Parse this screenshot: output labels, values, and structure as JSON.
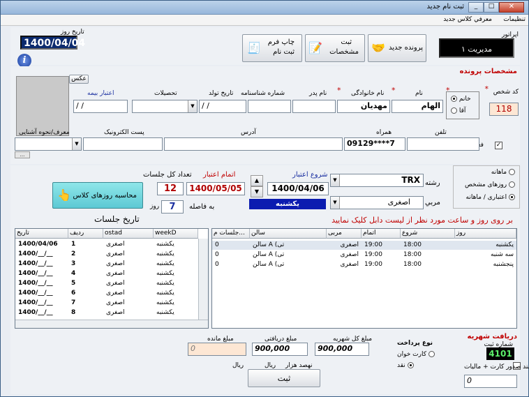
{
  "window": {
    "title": "ثبت نام جدید"
  },
  "menu": {
    "items": [
      "تنظیمات",
      "معرفي كلاس جديد"
    ]
  },
  "operator": {
    "label": "اپراتور",
    "value": "مدیریت ۱"
  },
  "date": {
    "label": "تاریخ روز",
    "value": "1400/04/04"
  },
  "toolbar": {
    "new_file": "پرونده جدید",
    "save_specs_1": "ثبت",
    "save_specs_2": "مشخصات",
    "print_1": "چاپ فرم",
    "print_2": "ثبت نام"
  },
  "section_profile": "مشخصات پرونده",
  "photo_label": "عکس",
  "fields": {
    "code_label": "کد شخص",
    "code": "118",
    "gender_female": "خانم",
    "gender_male": "آقا",
    "first_name_label": "نام",
    "first_name": "الهام",
    "last_name_label": "نام خانوادگی",
    "last_name": "مهدیان",
    "father_label": "نام پدر",
    "father": "",
    "id_label": "شماره شناسنامه",
    "id": "",
    "birth_label": "تاریخ تولد",
    "birth": "/ /",
    "education_label": "تحصیلات",
    "education": "",
    "insurance_label": "اعتبار بیمه",
    "insurance": "/ /",
    "phone_label": "تلفن",
    "phone": "",
    "mobile_label": "همراه",
    "mobile": "09129****7",
    "address_label": "آدرس",
    "address": "",
    "postal_label": "پست الکترونیک",
    "postal": "",
    "referrer_label": "معرف/نحوه آشنایی",
    "referrer": "",
    "active_label": "فعال"
  },
  "class": {
    "monthly": "ماهانه",
    "specific_days": "روزهای مشخص",
    "credit_monthly": "اعتباری / ماهانه",
    "field_label": "رشته",
    "field": "TRX",
    "coach_label": "مربي",
    "coach": "اصغری",
    "start_label": "شروع اعتبار",
    "start": "1400/04/06",
    "start_day": "یکشنبه",
    "end_label": "اتمام اعتبار",
    "end": "1400/05/05",
    "sessions_label": "تعداد کل جلسات",
    "sessions": "12",
    "interval_label": "به فاصله",
    "interval": "7",
    "interval_unit": "روز",
    "calc_button": "محاسبه روزهای کلاس",
    "hint": "بر روی روز و ساعت مورد نظر از لیست دابل کلیک نمایید"
  },
  "sessions_title": "تاریخ جلسات",
  "sessions_table": {
    "headers": [
      "تاریخ",
      "ردیف",
      "ostad",
      "weekD"
    ],
    "rows": [
      [
        "1400/04/06",
        "1",
        "اصغری",
        "یکشنبه"
      ],
      [
        "1400/__/__",
        "2",
        "اصغری",
        "یکشنبه"
      ],
      [
        "1400/__/__",
        "3",
        "اصغری",
        "یکشنبه"
      ],
      [
        "1400/__/__",
        "4",
        "اصغری",
        "یکشنبه"
      ],
      [
        "1400/__/__",
        "5",
        "اصغری",
        "یکشنبه"
      ],
      [
        "1400/__/__",
        "6",
        "اصغری",
        "یکشنبه"
      ],
      [
        "1400/__/__",
        "7",
        "اصغری",
        "یکشنبه"
      ],
      [
        "1400/__/__",
        "8",
        "اصغری",
        "یکشنبه"
      ]
    ]
  },
  "schedule_table": {
    "headers": [
      "روز",
      "شروع",
      "اتمام",
      "مربی",
      "سالن",
      "جلسات م..."
    ],
    "rows": [
      [
        "یکشنبه",
        "18:00",
        "19:00",
        "اصغری",
        "سالن A (تی",
        "0"
      ],
      [
        "سه شنبه",
        "18:00",
        "19:00",
        "اصغری",
        "سالن A (تی",
        "0"
      ],
      [
        "پنجشنبه",
        "18:00",
        "19:00",
        "اصغری",
        "سالن A (تی",
        "0"
      ]
    ]
  },
  "payment": {
    "title": "دریافت شهریه",
    "receipt_label": "شماره ثبت",
    "receipt": "4101",
    "method_label": "نوع پرداخت",
    "card": "کارت خوان",
    "cash": "نقد",
    "invoice_label": "سند صدور کارت + مالیات",
    "invoice_value": "0",
    "total_label": "مبلغ کل شهریه",
    "total": "900,000",
    "paid_label": "مبلغ دریافتی",
    "paid": "900,000",
    "remain_label": "مبلغ مانده",
    "remain": "0",
    "words": "نهصد هزار",
    "currency": "ریال",
    "currency2": "ریال",
    "submit": "ثبت"
  }
}
